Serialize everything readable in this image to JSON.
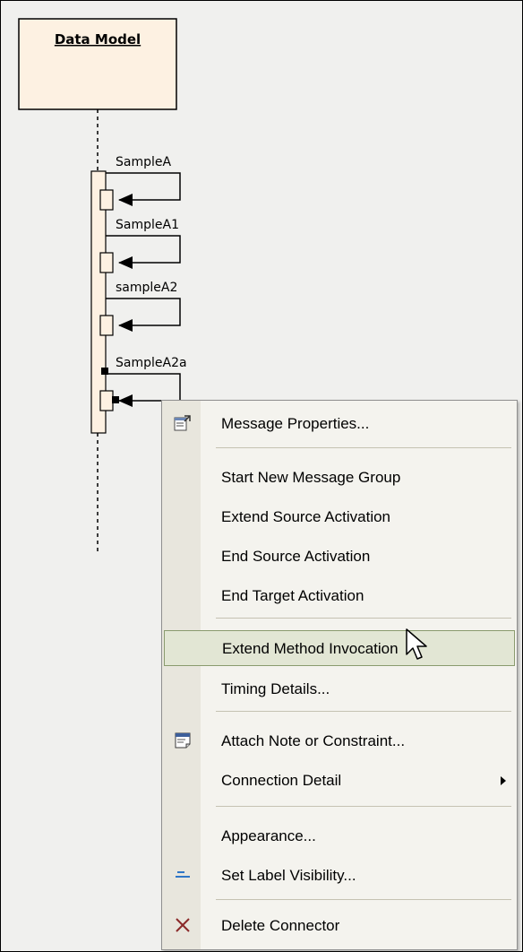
{
  "diagram": {
    "lifeline_title": "Data Model",
    "messages": [
      "SampleA",
      "SampleA1",
      "sampleA2",
      "SampleA2a"
    ]
  },
  "context_menu": {
    "items": [
      {
        "label": "Message Properties...",
        "icon": "properties-icon"
      },
      {
        "label": "Start New Message Group"
      },
      {
        "label": "Extend Source Activation"
      },
      {
        "label": "End Source Activation"
      },
      {
        "label": "End Target Activation"
      },
      {
        "label": "Extend Method Invocation",
        "highlighted": true
      },
      {
        "label": "Timing Details..."
      },
      {
        "label": "Attach Note or Constraint...",
        "icon": "note-icon"
      },
      {
        "label": "Connection Detail",
        "has_submenu": true
      },
      {
        "label": "Appearance..."
      },
      {
        "label": "Set Label Visibility...",
        "icon": "label-visibility-icon"
      },
      {
        "label": "Delete Connector",
        "icon": "delete-icon"
      }
    ]
  },
  "colors": {
    "canvas": "#f0f0ee",
    "lifeline_box": "#fdf1e2",
    "menu_bg": "#f4f3ee",
    "menu_gutter": "#e8e6dd",
    "highlight_bg": "#e2e6d4",
    "highlight_border": "#8a9b6e",
    "delete_icon": "#8b2a2a",
    "label_icon": "#2f76c7"
  }
}
